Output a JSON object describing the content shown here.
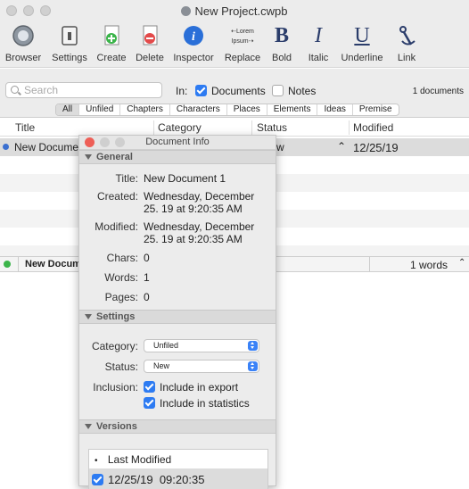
{
  "window": {
    "title": "New Project.cwpb"
  },
  "toolbar": {
    "browser": "Browser",
    "settings": "Settings",
    "create": "Create",
    "delete": "Delete",
    "inspector": "Inspector",
    "replace": "Replace",
    "bold": "Bold",
    "italic": "Italic",
    "underline": "Underline",
    "link": "Link",
    "replace_icon_top": "⇠Lorem",
    "replace_icon_bottom": "Ipsum⇢"
  },
  "filter": {
    "search_placeholder": "Search",
    "in_label": "In:",
    "documents_label": "Documents",
    "notes_label": "Notes",
    "count_text": "1 documents",
    "segments": [
      "All",
      "Unfiled",
      "Chapters",
      "Characters",
      "Places",
      "Elements",
      "Ideas",
      "Premise"
    ]
  },
  "table": {
    "columns": [
      "Title",
      "Category",
      "Status",
      "Modified"
    ],
    "rows": [
      {
        "title": "New Docume",
        "status": "w",
        "modified": "12/25/19"
      }
    ]
  },
  "bottombar": {
    "doc": "New Docum",
    "words": "1 words"
  },
  "info_panel": {
    "title": "Document Info",
    "general_header": "General",
    "title_label": "Title:",
    "title_value": "New Document 1",
    "created_label": "Created:",
    "created_line1": "Wednesday, December",
    "created_line2": "25. 19 at 9:20:35 AM",
    "modified_label": "Modified:",
    "modified_line1": "Wednesday, December",
    "modified_line2": "25. 19 at 9:20:35 AM",
    "chars_label": "Chars:",
    "chars_value": "0",
    "words_label": "Words:",
    "words_value": "1",
    "pages_label": "Pages:",
    "pages_value": "0",
    "settings_header": "Settings",
    "category_label": "Category:",
    "category_value": "Unfiled",
    "status_label": "Status:",
    "status_value": "New",
    "inclusion_label": "Inclusion:",
    "include_export": "Include in export",
    "include_stats": "Include in statistics",
    "versions_header": "Versions",
    "versions_col_bullet": "•",
    "versions_col": "Last Modified",
    "version_entry": "12/25/19  09:20:35"
  },
  "colors": {
    "accent": "#2d7bf2",
    "selected_row": "#dcdcdc",
    "close_red": "#ee5f57"
  }
}
